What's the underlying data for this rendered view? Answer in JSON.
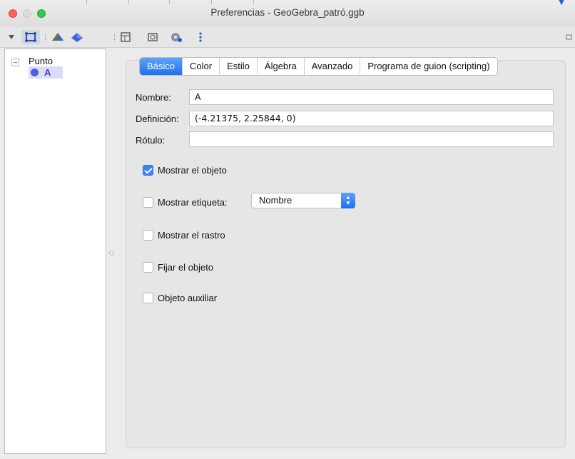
{
  "window": {
    "title": "Preferencias - GeoGebra_patró.ggb"
  },
  "toolbar": {
    "icons": [
      "graphics-view-icon",
      "3d-graphics-icon",
      "3d-view-icon",
      "layout-icon",
      "properties-graphics-icon",
      "algebra-settings-icon",
      "more-icon"
    ]
  },
  "tree": {
    "group_label": "Punto",
    "items": [
      {
        "label": "A",
        "color": "#4a5fe2"
      }
    ]
  },
  "tabs": [
    {
      "label": "Básico",
      "active": true
    },
    {
      "label": "Color"
    },
    {
      "label": "Estilo"
    },
    {
      "label": "Álgebra"
    },
    {
      "label": "Avanzado"
    },
    {
      "label": "Programa de guion (scripting)"
    }
  ],
  "form": {
    "name_label": "Nombre:",
    "name_value": "A",
    "definition_label": "Definición:",
    "definition_value": "(-4.21375, 2.25844, 0)",
    "caption_label": "Rótulo:",
    "caption_value": ""
  },
  "options": {
    "show_object": {
      "label": "Mostrar el objeto",
      "checked": true
    },
    "show_label": {
      "label": "Mostrar etiqueta:",
      "checked": false,
      "select_value": "Nombre"
    },
    "show_trace": {
      "label": "Mostrar el rastro",
      "checked": false
    },
    "fix_object": {
      "label": "Fijar el objeto",
      "checked": false
    },
    "auxiliary_object": {
      "label": "Objeto auxiliar",
      "checked": false
    }
  },
  "colors": {
    "accent": "#1f6fef",
    "selection": "#dcdcf6"
  }
}
